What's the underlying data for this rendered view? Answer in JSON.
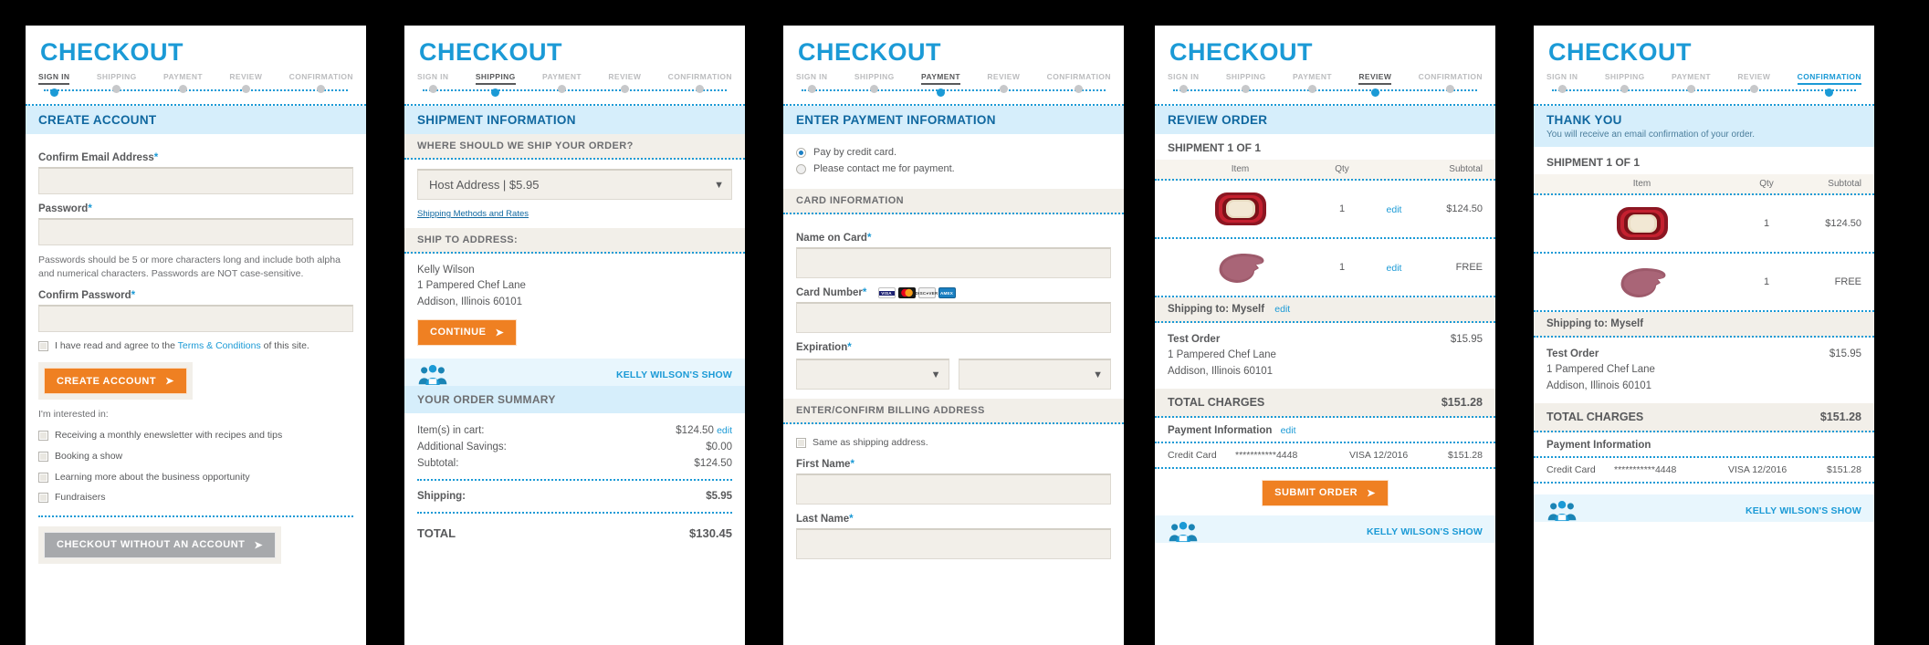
{
  "brand": {
    "accent": "#1b9ad6",
    "orange": "#ef8022",
    "grey": "#a7a9ac",
    "bar_blue": "#d6eefb",
    "bar_grey": "#f2efe9"
  },
  "title": "CHECKOUT",
  "steps": [
    "SIGN IN",
    "SHIPPING",
    "PAYMENT",
    "REVIEW",
    "CONFIRMATION"
  ],
  "panel1": {
    "active_step": "SIGN IN",
    "section_title": "CREATE ACCOUNT",
    "email_label": "Confirm Email Address",
    "password_label": "Password",
    "password_help": "Passwords should be 5 or more characters long and include both alpha and numerical characters. Passwords are NOT case-sensitive.",
    "confirm_password_label": "Confirm Password",
    "terms_pre": "I have read and agree to the ",
    "terms_link": "Terms & Conditions",
    "terms_post": " of this site.",
    "create_account_button": "CREATE ACCOUNT",
    "interested_label": "I'm interested in:",
    "interests": [
      "Receiving a monthly enewsletter with recipes and tips",
      "Booking a show",
      "Learning more about the business opportunity",
      "Fundraisers"
    ],
    "guest_button": "CHECKOUT WITHOUT AN ACCOUNT"
  },
  "panel2": {
    "active_step": "SHIPPING",
    "section_title": "SHIPMENT INFORMATION",
    "where_ship_label": "WHERE SHOULD WE SHIP YOUR ORDER?",
    "ship_option": "Host Address | $5.95",
    "rates_link": "Shipping Methods and Rates",
    "ship_to_label": "SHIP TO ADDRESS:",
    "address_name": "Kelly Wilson",
    "address_street": "1 Pampered Chef Lane",
    "address_citystate": "Addison, Illinois 60101",
    "continue_button": "CONTINUE",
    "show_name": "KELLY WILSON'S SHOW",
    "summary_title": "YOUR ORDER SUMMARY",
    "summary_rows": [
      {
        "label": "Item(s) in cart:",
        "value": "$124.50",
        "edit": "edit"
      },
      {
        "label": "Additional Savings:",
        "value": "$0.00"
      },
      {
        "label": "Subtotal:",
        "value": "$124.50"
      }
    ],
    "shipping_label": "Shipping:",
    "shipping_value": "$5.95",
    "total_label": "TOTAL",
    "total_value": "$130.45"
  },
  "panel3": {
    "active_step": "PAYMENT",
    "section_title": "ENTER PAYMENT INFORMATION",
    "pay_options": [
      {
        "label": "Pay by credit card.",
        "selected": true
      },
      {
        "label": "Please contact me for payment.",
        "selected": false
      }
    ],
    "card_info_label": "CARD INFORMATION",
    "name_on_card_label": "Name on Card",
    "card_number_label": "Card Number",
    "card_icons": [
      "visa-card-icon",
      "mastercard-card-icon",
      "discover-card-icon",
      "amex-card-icon"
    ],
    "expiration_label": "Expiration",
    "billing_label": "ENTER/CONFIRM BILLING ADDRESS",
    "same_as_shipping": "Same as shipping address.",
    "first_name_label": "First Name",
    "last_name_label": "Last Name"
  },
  "panel4": {
    "active_step": "REVIEW",
    "section_title": "REVIEW ORDER",
    "shipment_label": "SHIPMENT 1 OF 1",
    "columns": [
      "Item",
      "Qty",
      "",
      "Subtotal"
    ],
    "rows": [
      {
        "item": "nesting-bowls-product-image",
        "qty": "1",
        "edit": "edit",
        "subtotal": "$124.50"
      },
      {
        "item": "oven-mitt-product-image",
        "qty": "1",
        "edit": "edit",
        "subtotal": "FREE"
      }
    ],
    "shipping_to": "Shipping to: Myself",
    "shipping_to_edit": "edit",
    "order_name": "Test Order",
    "order_street": "1 Pampered Chef Lane",
    "order_citystate": "Addison, Illinois 60101",
    "order_ship_cost": "$15.95",
    "total_label": "TOTAL CHARGES",
    "total_value": "$151.28",
    "payment_title": "Payment Information",
    "payment_edit": "edit",
    "payment_type": "Credit Card",
    "payment_masked": "***********4448",
    "payment_brand": "VISA 12/2016",
    "payment_amount": "$151.28",
    "submit_button": "SUBMIT ORDER",
    "show_name": "KELLY WILSON'S SHOW"
  },
  "panel5": {
    "active_step": "CONFIRMATION",
    "section_title": "THANK YOU",
    "section_sub": "You will receive an email confirmation of your order.",
    "shipment_label": "SHIPMENT 1 OF 1",
    "columns": [
      "Item",
      "Qty",
      "Subtotal"
    ],
    "rows": [
      {
        "item": "nesting-bowls-product-image",
        "qty": "1",
        "subtotal": "$124.50"
      },
      {
        "item": "oven-mitt-product-image",
        "qty": "1",
        "subtotal": "FREE"
      }
    ],
    "shipping_to": "Shipping to: Myself",
    "order_name": "Test Order",
    "order_street": "1 Pampered Chef Lane",
    "order_citystate": "Addison, Illinois 60101",
    "order_ship_cost": "$15.95",
    "total_label": "TOTAL CHARGES",
    "total_value": "$151.28",
    "payment_title": "Payment Information",
    "payment_type": "Credit Card",
    "payment_masked": "***********4448",
    "payment_brand": "VISA 12/2016",
    "payment_amount": "$151.28",
    "show_name": "KELLY WILSON'S SHOW"
  }
}
